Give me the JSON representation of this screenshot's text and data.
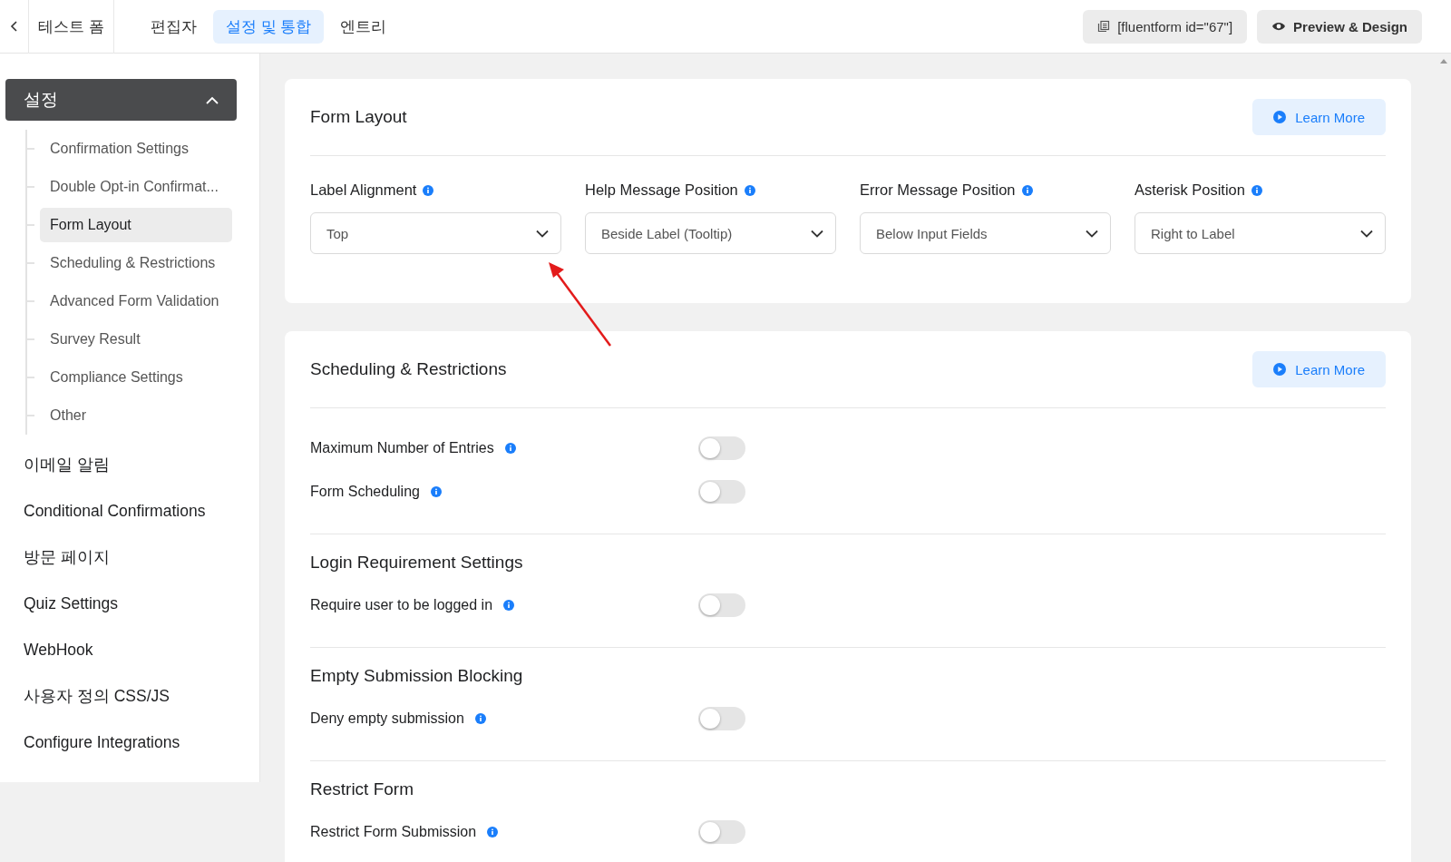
{
  "header": {
    "form_title": "테스트 폼",
    "tabs": [
      {
        "label": "편집자",
        "selected": false
      },
      {
        "label": "설정 및 통합",
        "selected": true
      },
      {
        "label": "엔트리",
        "selected": false
      }
    ],
    "shortcode_button": "[fluentform id=\"67\"]",
    "preview_button": "Preview & Design"
  },
  "sidebar": {
    "group": {
      "label": "설정",
      "expanded": true,
      "children": [
        {
          "label": "Confirmation Settings",
          "selected": false
        },
        {
          "label": "Double Opt-in Confirmat...",
          "selected": false
        },
        {
          "label": "Form Layout",
          "selected": true
        },
        {
          "label": "Scheduling & Restrictions",
          "selected": false
        },
        {
          "label": "Advanced Form Validation",
          "selected": false
        },
        {
          "label": "Survey Result",
          "selected": false
        },
        {
          "label": "Compliance Settings",
          "selected": false
        },
        {
          "label": "Other",
          "selected": false
        }
      ]
    },
    "items": [
      "이메일 알림",
      "Conditional Confirmations",
      "방문 페이지",
      "Quiz Settings",
      "WebHook",
      "사용자 정의 CSS/JS",
      "Configure Integrations"
    ]
  },
  "form_layout": {
    "title": "Form Layout",
    "learn_more": "Learn More",
    "fields": [
      {
        "label": "Label Alignment",
        "value": "Top"
      },
      {
        "label": "Help Message Position",
        "value": "Beside Label (Tooltip)"
      },
      {
        "label": "Error Message Position",
        "value": "Below Input Fields"
      },
      {
        "label": "Asterisk Position",
        "value": "Right to Label"
      }
    ]
  },
  "scheduling": {
    "title": "Scheduling & Restrictions",
    "learn_more": "Learn More",
    "sections": [
      {
        "settings": [
          {
            "label": "Maximum Number of Entries",
            "on": false
          },
          {
            "label": "Form Scheduling",
            "on": false
          }
        ]
      },
      {
        "heading": "Login Requirement Settings",
        "settings": [
          {
            "label": "Require user to be logged in",
            "on": false
          }
        ]
      },
      {
        "heading": "Empty Submission Blocking",
        "settings": [
          {
            "label": "Deny empty submission",
            "on": false
          }
        ]
      },
      {
        "heading": "Restrict Form",
        "settings": [
          {
            "label": "Restrict Form Submission",
            "on": false
          }
        ]
      }
    ]
  }
}
